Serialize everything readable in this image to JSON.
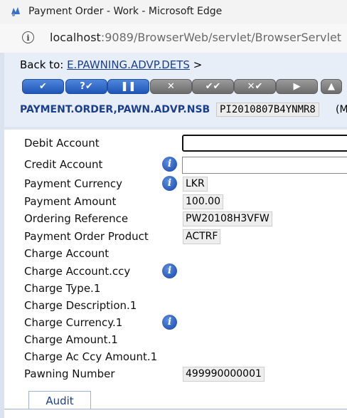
{
  "window": {
    "title": "Payment Order - Work - Microsoft Edge"
  },
  "address_bar": {
    "host": "localhost",
    "path": ":9089/BrowserWeb/servlet/BrowserServlet"
  },
  "header": {
    "back_prefix": "Back to:",
    "back_link": "E.PAWNING.ADVP.DETS",
    "back_suffix": ">",
    "version_name": "PAYMENT.ORDER,PAWN.ADVP.NSB",
    "transaction_id": "PI2010807B4YNMR8",
    "trailing_text": "(M"
  },
  "toolbar": {
    "commit_glyph": "✔",
    "validate_glyph": "?✔",
    "hold_glyph": "❚❚",
    "delete_glyph": "✕",
    "authorise_glyph": "✔✔",
    "reverse_glyph": "✕✔",
    "next_glyph": "▶",
    "upload_glyph": "▲"
  },
  "form": {
    "fields": {
      "debit_account": {
        "label": "Debit Account",
        "value": ""
      },
      "credit_account": {
        "label": "Credit Account",
        "value": ""
      },
      "payment_currency": {
        "label": "Payment Currency",
        "value": "LKR"
      },
      "payment_amount": {
        "label": "Payment Amount",
        "value": "100.00"
      },
      "ordering_reference": {
        "label": "Ordering Reference",
        "value": "PW20108H3VFW"
      },
      "payment_order_product": {
        "label": "Payment Order Product",
        "value": "ACTRF"
      },
      "charge_account": {
        "label": "Charge Account"
      },
      "charge_account_ccy": {
        "label": "Charge Account.ccy"
      },
      "charge_type": {
        "label": "Charge Type.1"
      },
      "charge_description": {
        "label": "Charge Description.1"
      },
      "charge_currency": {
        "label": "Charge Currency.1"
      },
      "charge_amount": {
        "label": "Charge Amount.1"
      },
      "charge_ac_ccy_amount": {
        "label": "Charge Ac Ccy Amount.1"
      },
      "pawning_number": {
        "label": "Pawning Number",
        "value": "499990000001"
      }
    },
    "info_glyph": "i"
  },
  "tabs": {
    "audit": "Audit"
  }
}
